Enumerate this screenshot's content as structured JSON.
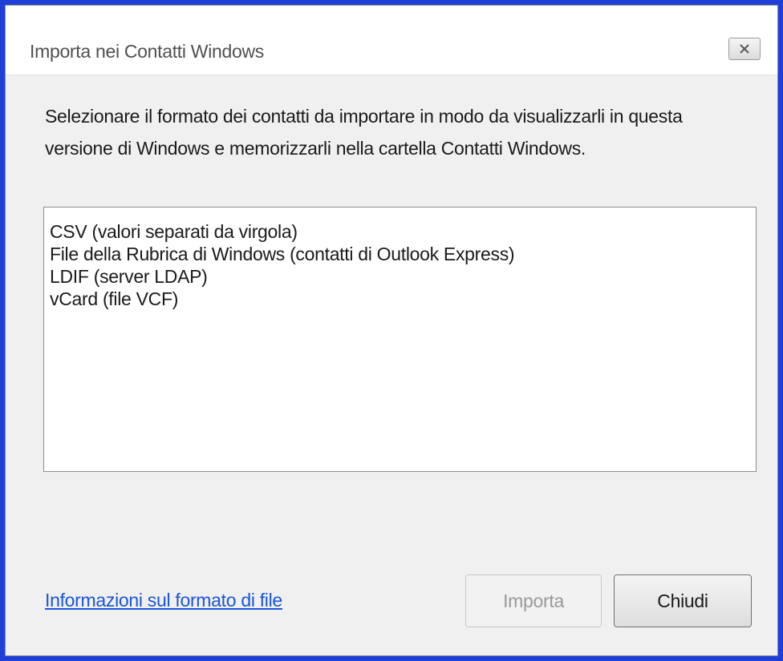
{
  "window": {
    "title": "Importa nei Contatti Windows",
    "close_icon": "close-x-icon"
  },
  "instructions": "Selezionare il formato dei contatti da importare in modo da visualizzarli in questa versione di Windows e memorizzarli nella cartella Contatti Windows.",
  "formats": [
    "CSV (valori separati da virgola)",
    "File della Rubrica di Windows (contatti di Outlook Express)",
    "LDIF (server LDAP)",
    "vCard (file VCF)"
  ],
  "footer": {
    "link_label": "Informazioni sul formato di file",
    "import_label": "Importa",
    "import_enabled": false,
    "close_label": "Chiudi"
  },
  "colors": {
    "frame_border": "#1e3fd8",
    "link": "#1a56d8",
    "disabled_text": "#9a9a9a"
  }
}
